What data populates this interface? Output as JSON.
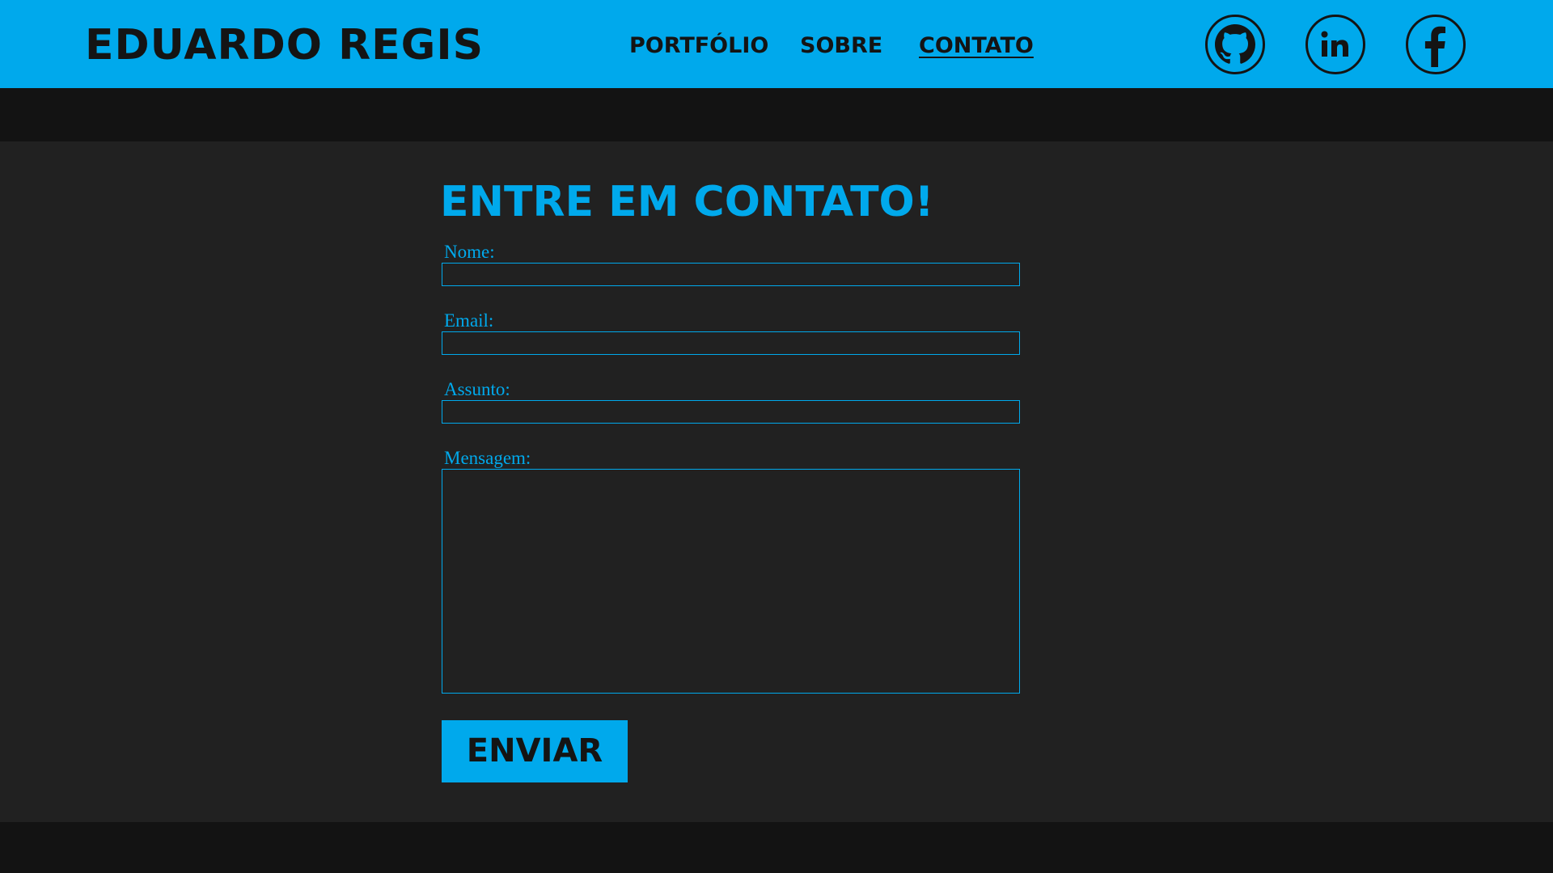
{
  "header": {
    "logo": "EDUARDO REGIS",
    "nav": [
      {
        "label": "PORTFÓLIO",
        "active": false
      },
      {
        "label": "SOBRE",
        "active": false
      },
      {
        "label": "CONTATO",
        "active": true
      }
    ],
    "social": [
      {
        "name": "github-icon"
      },
      {
        "name": "linkedin-icon",
        "text": "in"
      },
      {
        "name": "facebook-icon",
        "text": "f"
      }
    ]
  },
  "form": {
    "title": "ENTRE EM CONTATO!",
    "fields": {
      "name": {
        "label": "Nome:",
        "value": ""
      },
      "email": {
        "label": "Email:",
        "value": ""
      },
      "subject": {
        "label": "Assunto:",
        "value": ""
      },
      "message": {
        "label": "Mensagem:",
        "value": ""
      }
    },
    "submit_label": "ENVIAR"
  },
  "colors": {
    "accent": "#00a9ec",
    "background": "#212121",
    "band": "#131313",
    "text_dark": "#141414"
  }
}
